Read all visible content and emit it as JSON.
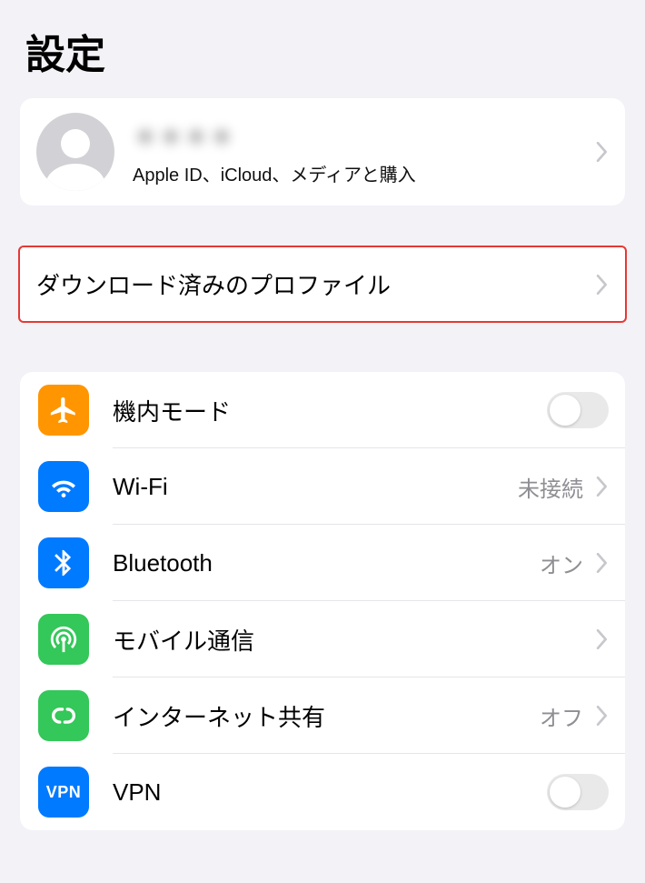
{
  "title": "設定",
  "profile": {
    "name": "＊＊＊＊",
    "subtitle": "Apple ID、iCloud、メディアと購入"
  },
  "download_profile": {
    "label": "ダウンロード済みのプロファイル"
  },
  "rows": {
    "airplane": {
      "label": "機内モード"
    },
    "wifi": {
      "label": "Wi-Fi",
      "value": "未接続"
    },
    "bluetooth": {
      "label": "Bluetooth",
      "value": "オン"
    },
    "cellular": {
      "label": "モバイル通信"
    },
    "hotspot": {
      "label": "インターネット共有",
      "value": "オフ"
    },
    "vpn": {
      "label": "VPN",
      "badge": "VPN"
    }
  }
}
